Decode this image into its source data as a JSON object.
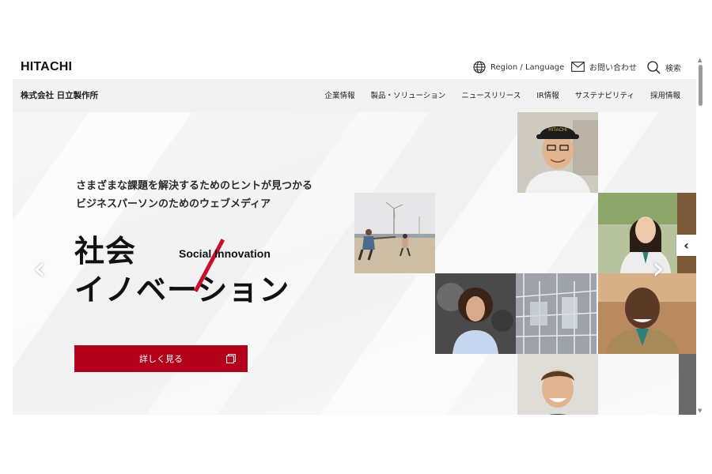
{
  "header": {
    "logo": "HITACHI",
    "region_language": "Region / Language",
    "contact": "お問い合わせ",
    "search": "検索"
  },
  "nav": {
    "company": "株式会社 日立製作所",
    "links": [
      "企業情報",
      "製品・ソリューション",
      "ニュースリリース",
      "IR情報",
      "サステナビリティ",
      "採用情報"
    ]
  },
  "hero": {
    "tagline_line1": "さまざまな課題を解決するためのヒントが見つかる",
    "tagline_line2": "ビジネスパーソンのためのウェブメディア",
    "title_line1": "社会",
    "title_line2": "イノベーション",
    "title_en": "Social Innovation",
    "cta_label": "詳しく見る",
    "prev_arrow": "‹",
    "next_arrow": "›",
    "side_tab_arrow": "‹",
    "cap_text": "HITACHI"
  },
  "colors": {
    "brand_red": "#b3001b",
    "accent_slash": "#c8102e",
    "nav_bg": "#f2f2f2"
  }
}
